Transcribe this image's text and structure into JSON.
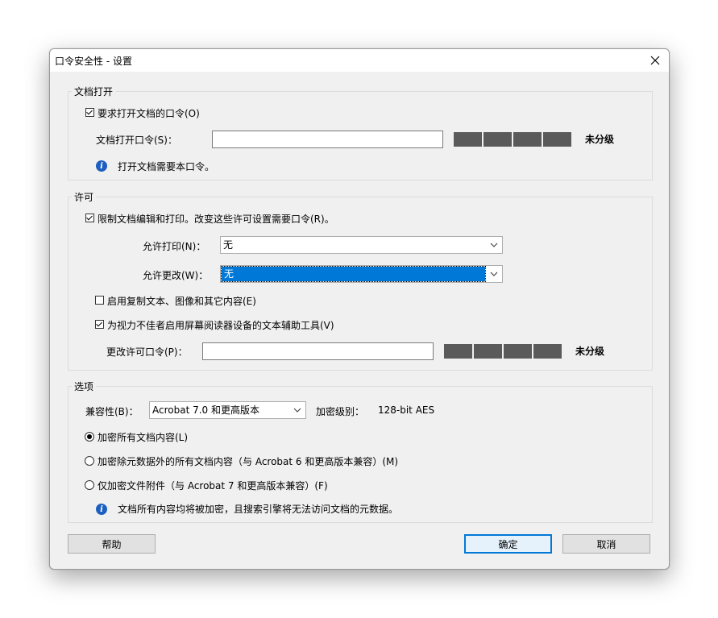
{
  "window": {
    "title": "口令安全性 - 设置"
  },
  "doc_open": {
    "group_label": "文档打开",
    "require_password_label": "要求打开文档的口令(O)",
    "require_password_checked": true,
    "password_label": "文档打开口令(S)：",
    "password_value": "",
    "strength_label": "未分级",
    "info_text": "打开文档需要本口令。"
  },
  "permissions": {
    "group_label": "许可",
    "restrict_label": "限制文档编辑和打印。改变这些许可设置需要口令(R)。",
    "restrict_checked": true,
    "allow_print_label": "允许打印(N)：",
    "allow_print_value": "无",
    "allow_change_label": "允许更改(W)：",
    "allow_change_value": "无",
    "enable_copy_label": "启用复制文本、图像和其它内容(E)",
    "enable_copy_checked": false,
    "screen_reader_label": "为视力不佳者启用屏幕阅读器设备的文本辅助工具(V)",
    "screen_reader_checked": true,
    "change_password_label": "更改许可口令(P)：",
    "change_password_value": "",
    "strength_label": "未分级"
  },
  "options": {
    "group_label": "选项",
    "compat_label": "兼容性(B)：",
    "compat_value": "Acrobat 7.0 和更高版本",
    "encrypt_level_label": "加密级别：",
    "encrypt_level_value": "128-bit AES",
    "radio_all": "加密所有文档内容(L)",
    "radio_except_meta": "加密除元数据外的所有文档内容（与 Acrobat 6 和更高版本兼容）(M)",
    "radio_attachments": "仅加密文件附件（与 Acrobat 7 和更高版本兼容）(F)",
    "selected_radio": "all",
    "info_text": "文档所有内容均将被加密，且搜索引擎将无法访问文档的元数据。"
  },
  "buttons": {
    "help": "帮助",
    "ok": "确定",
    "cancel": "取消"
  },
  "colors": {
    "strength_segment": "#5a5a5a",
    "accent": "#0078d7",
    "info_icon": "#1c5fc0"
  }
}
